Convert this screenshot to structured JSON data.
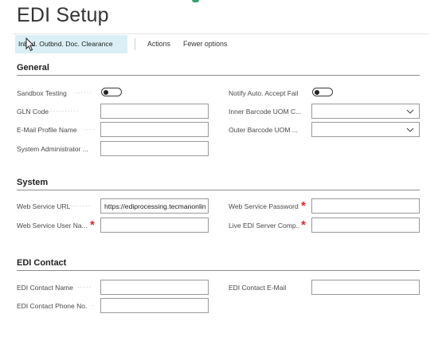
{
  "page": {
    "title": "EDI Setup"
  },
  "toolbar": {
    "active_action": "Inbnd. Outbnd. Doc. Clearance",
    "actions_label": "Actions",
    "fewer_options_label": "Fewer options"
  },
  "sections": {
    "general": {
      "title": "General",
      "sandbox_testing": {
        "label": "Sandbox Testing",
        "value": false
      },
      "gln_code": {
        "label": "GLN Code",
        "value": ""
      },
      "email_profile_name": {
        "label": "E-Mail Profile Name",
        "value": ""
      },
      "system_administrator": {
        "label": "System Administrator ...",
        "value": ""
      },
      "notify_auto_accept_fail": {
        "label": "Notify Auto. Accept Fail",
        "value": false
      },
      "inner_barcode_uom": {
        "label": "Inner Barcode UOM C...",
        "value": ""
      },
      "outer_barcode_uom": {
        "label": "Outer Barcode UOM ...",
        "value": ""
      }
    },
    "system": {
      "title": "System",
      "web_service_url": {
        "label": "Web Service URL",
        "value": "https://ediprocessing.tecmanonlin"
      },
      "web_service_user_name": {
        "label": "Web Service User Na...",
        "value": ""
      },
      "web_service_password": {
        "label": "Web Service Password",
        "value": ""
      },
      "live_edi_server_comp": {
        "label": "Live EDI Server Comp...",
        "value": ""
      }
    },
    "edi_contact": {
      "title": "EDI Contact",
      "contact_name": {
        "label": "EDI Contact Name",
        "value": ""
      },
      "contact_phone": {
        "label": "EDI Contact Phone No.",
        "value": ""
      },
      "contact_email": {
        "label": "EDI Contact E-Mail",
        "value": ""
      }
    }
  },
  "colors": {
    "accent_green": "#38a169",
    "active_tab_bg": "#daeff5",
    "required_red": "#e02424"
  },
  "icons": {
    "cursor": "mouse-pointer-icon",
    "dropdown": "chevron-down-icon",
    "required": "required-asterisk"
  }
}
